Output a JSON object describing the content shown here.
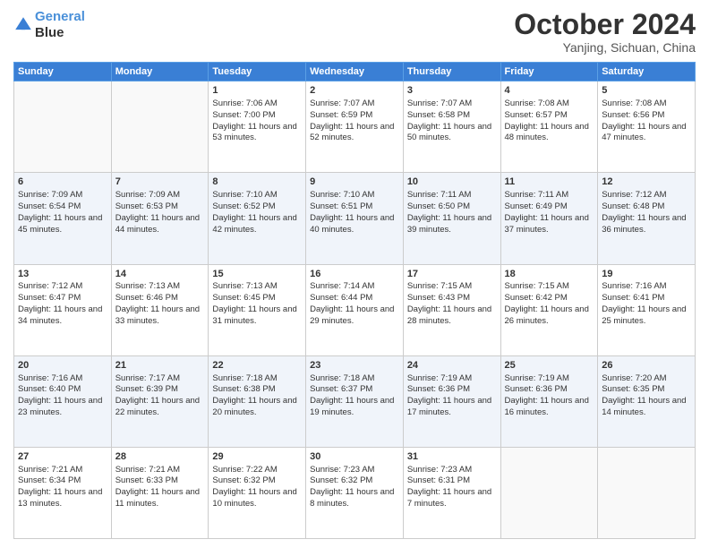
{
  "logo": {
    "line1": "General",
    "line2": "Blue"
  },
  "title": "October 2024",
  "location": "Yanjing, Sichuan, China",
  "days_header": [
    "Sunday",
    "Monday",
    "Tuesday",
    "Wednesday",
    "Thursday",
    "Friday",
    "Saturday"
  ],
  "weeks": [
    [
      {
        "day": "",
        "info": ""
      },
      {
        "day": "",
        "info": ""
      },
      {
        "day": "1",
        "info": "Sunrise: 7:06 AM\nSunset: 7:00 PM\nDaylight: 11 hours and 53 minutes."
      },
      {
        "day": "2",
        "info": "Sunrise: 7:07 AM\nSunset: 6:59 PM\nDaylight: 11 hours and 52 minutes."
      },
      {
        "day": "3",
        "info": "Sunrise: 7:07 AM\nSunset: 6:58 PM\nDaylight: 11 hours and 50 minutes."
      },
      {
        "day": "4",
        "info": "Sunrise: 7:08 AM\nSunset: 6:57 PM\nDaylight: 11 hours and 48 minutes."
      },
      {
        "day": "5",
        "info": "Sunrise: 7:08 AM\nSunset: 6:56 PM\nDaylight: 11 hours and 47 minutes."
      }
    ],
    [
      {
        "day": "6",
        "info": "Sunrise: 7:09 AM\nSunset: 6:54 PM\nDaylight: 11 hours and 45 minutes."
      },
      {
        "day": "7",
        "info": "Sunrise: 7:09 AM\nSunset: 6:53 PM\nDaylight: 11 hours and 44 minutes."
      },
      {
        "day": "8",
        "info": "Sunrise: 7:10 AM\nSunset: 6:52 PM\nDaylight: 11 hours and 42 minutes."
      },
      {
        "day": "9",
        "info": "Sunrise: 7:10 AM\nSunset: 6:51 PM\nDaylight: 11 hours and 40 minutes."
      },
      {
        "day": "10",
        "info": "Sunrise: 7:11 AM\nSunset: 6:50 PM\nDaylight: 11 hours and 39 minutes."
      },
      {
        "day": "11",
        "info": "Sunrise: 7:11 AM\nSunset: 6:49 PM\nDaylight: 11 hours and 37 minutes."
      },
      {
        "day": "12",
        "info": "Sunrise: 7:12 AM\nSunset: 6:48 PM\nDaylight: 11 hours and 36 minutes."
      }
    ],
    [
      {
        "day": "13",
        "info": "Sunrise: 7:12 AM\nSunset: 6:47 PM\nDaylight: 11 hours and 34 minutes."
      },
      {
        "day": "14",
        "info": "Sunrise: 7:13 AM\nSunset: 6:46 PM\nDaylight: 11 hours and 33 minutes."
      },
      {
        "day": "15",
        "info": "Sunrise: 7:13 AM\nSunset: 6:45 PM\nDaylight: 11 hours and 31 minutes."
      },
      {
        "day": "16",
        "info": "Sunrise: 7:14 AM\nSunset: 6:44 PM\nDaylight: 11 hours and 29 minutes."
      },
      {
        "day": "17",
        "info": "Sunrise: 7:15 AM\nSunset: 6:43 PM\nDaylight: 11 hours and 28 minutes."
      },
      {
        "day": "18",
        "info": "Sunrise: 7:15 AM\nSunset: 6:42 PM\nDaylight: 11 hours and 26 minutes."
      },
      {
        "day": "19",
        "info": "Sunrise: 7:16 AM\nSunset: 6:41 PM\nDaylight: 11 hours and 25 minutes."
      }
    ],
    [
      {
        "day": "20",
        "info": "Sunrise: 7:16 AM\nSunset: 6:40 PM\nDaylight: 11 hours and 23 minutes."
      },
      {
        "day": "21",
        "info": "Sunrise: 7:17 AM\nSunset: 6:39 PM\nDaylight: 11 hours and 22 minutes."
      },
      {
        "day": "22",
        "info": "Sunrise: 7:18 AM\nSunset: 6:38 PM\nDaylight: 11 hours and 20 minutes."
      },
      {
        "day": "23",
        "info": "Sunrise: 7:18 AM\nSunset: 6:37 PM\nDaylight: 11 hours and 19 minutes."
      },
      {
        "day": "24",
        "info": "Sunrise: 7:19 AM\nSunset: 6:36 PM\nDaylight: 11 hours and 17 minutes."
      },
      {
        "day": "25",
        "info": "Sunrise: 7:19 AM\nSunset: 6:36 PM\nDaylight: 11 hours and 16 minutes."
      },
      {
        "day": "26",
        "info": "Sunrise: 7:20 AM\nSunset: 6:35 PM\nDaylight: 11 hours and 14 minutes."
      }
    ],
    [
      {
        "day": "27",
        "info": "Sunrise: 7:21 AM\nSunset: 6:34 PM\nDaylight: 11 hours and 13 minutes."
      },
      {
        "day": "28",
        "info": "Sunrise: 7:21 AM\nSunset: 6:33 PM\nDaylight: 11 hours and 11 minutes."
      },
      {
        "day": "29",
        "info": "Sunrise: 7:22 AM\nSunset: 6:32 PM\nDaylight: 11 hours and 10 minutes."
      },
      {
        "day": "30",
        "info": "Sunrise: 7:23 AM\nSunset: 6:32 PM\nDaylight: 11 hours and 8 minutes."
      },
      {
        "day": "31",
        "info": "Sunrise: 7:23 AM\nSunset: 6:31 PM\nDaylight: 11 hours and 7 minutes."
      },
      {
        "day": "",
        "info": ""
      },
      {
        "day": "",
        "info": ""
      }
    ]
  ]
}
